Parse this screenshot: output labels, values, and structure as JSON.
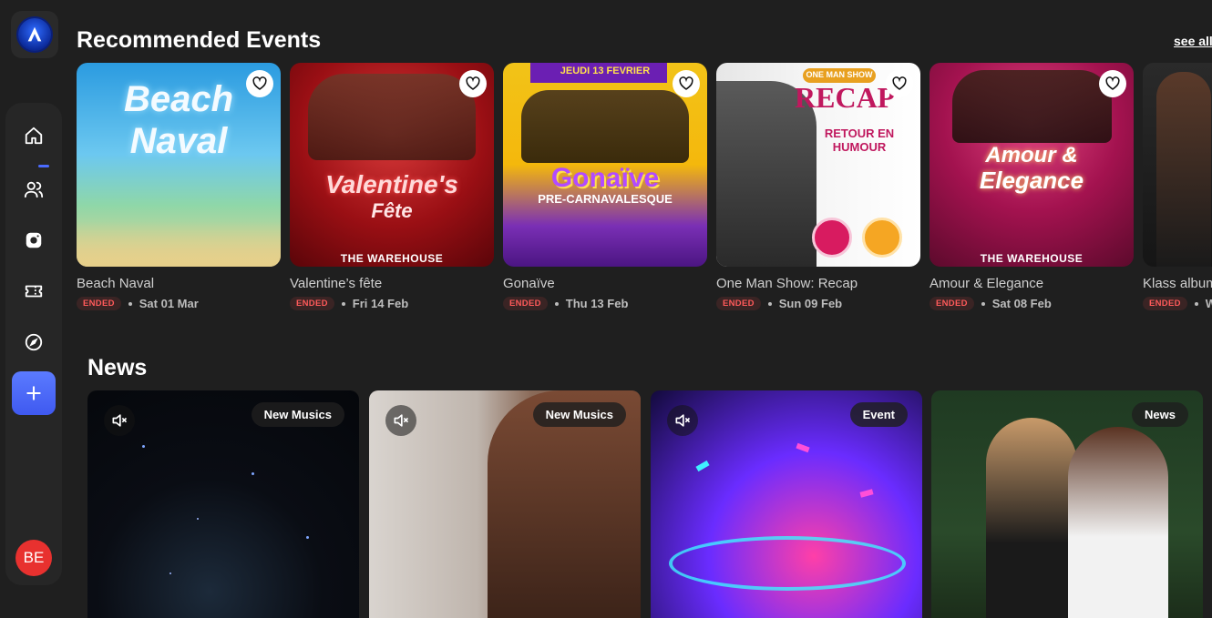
{
  "sidebar": {
    "logo_icon": "app-logo-icon",
    "nav": [
      {
        "name": "home-icon",
        "active": true
      },
      {
        "name": "users-icon"
      },
      {
        "name": "camera-icon"
      },
      {
        "name": "ticket-icon"
      },
      {
        "name": "compass-icon"
      }
    ],
    "add_icon": "plus-icon",
    "avatar_initials": "BE"
  },
  "recommended": {
    "title": "Recommended Events",
    "see_all": "see all",
    "events": [
      {
        "title": "Beach Naval",
        "status": "ENDED",
        "date": "Sat 01 Mar"
      },
      {
        "title": "Valentine’s fête",
        "status": "ENDED",
        "date": "Fri 14 Feb"
      },
      {
        "title": "Gonaïve",
        "status": "ENDED",
        "date": "Thu 13 Feb"
      },
      {
        "title": "One Man Show: Recap",
        "status": "ENDED",
        "date": "Sun 09 Feb"
      },
      {
        "title": "Amour & Elegance",
        "status": "ENDED",
        "date": "Sat 08 Feb"
      },
      {
        "title": "Klass album",
        "status": "ENDED",
        "date": "W"
      }
    ],
    "posters": {
      "p1": {
        "line1": "Beach",
        "line2": "Naval"
      },
      "p2": {
        "line1": "Valentine's",
        "line2": "Fête",
        "footer": "THE WAREHOUSE"
      },
      "p3": {
        "top": "JEUDI 13 FEVRIER",
        "line1": "Gonaïve",
        "line2": "PRE-CARNAVALESQUE"
      },
      "p4": {
        "top": "ONE MAN SHOW",
        "line1": "RECAP",
        "line2": "RETOUR EN HUMOUR"
      },
      "p5": {
        "line1": "Amour &",
        "line2": "Elegance",
        "footer": "THE WAREHOUSE"
      }
    }
  },
  "news": {
    "title": "News",
    "items": [
      {
        "tag": "New Musics"
      },
      {
        "tag": "New Musics"
      },
      {
        "tag": "Event"
      },
      {
        "tag": "News"
      }
    ]
  },
  "colors": {
    "accent": "#4b6bff",
    "ended_text": "#ff5a5a",
    "background": "#1f1f1f"
  }
}
